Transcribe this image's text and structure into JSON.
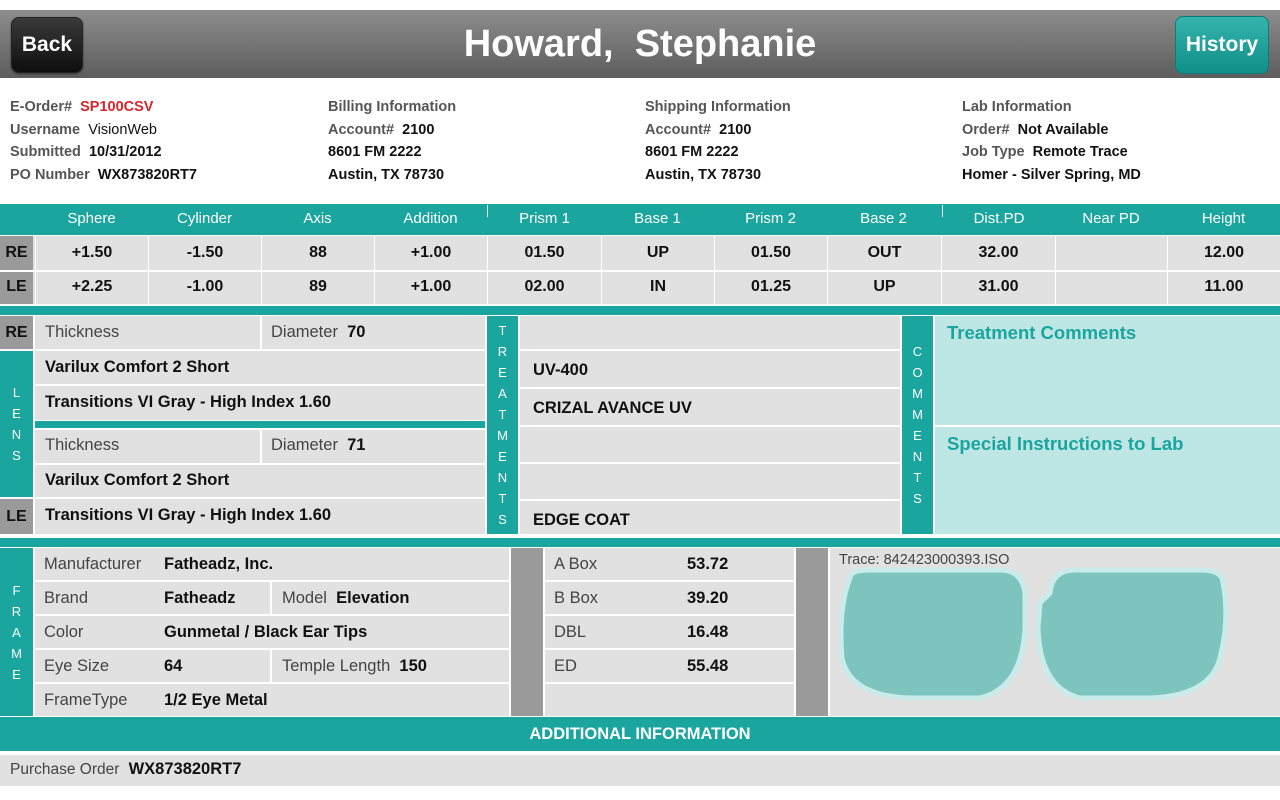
{
  "header": {
    "back_label": "Back",
    "title": "Howard,  Stephanie",
    "history_label": "History"
  },
  "order": {
    "eorder_label": "E-Order#",
    "eorder_value": "SP100CSV",
    "username_label": "Username",
    "username_value": "VisionWeb",
    "submitted_label": "Submitted",
    "submitted_value": "10/31/2012",
    "po_label": "PO Number",
    "po_value": "WX873820RT7"
  },
  "billing": {
    "title": "Billing Information",
    "account_label": "Account#",
    "account_value": "2100",
    "address1": "8601 FM 2222",
    "address2": "Austin, TX 78730"
  },
  "shipping": {
    "title": "Shipping Information",
    "account_label": "Account#",
    "account_value": "2100",
    "address1": "8601 FM 2222",
    "address2": "Austin, TX 78730"
  },
  "lab": {
    "title": "Lab Information",
    "order_label": "Order#",
    "order_value": "Not Available",
    "jobtype_label": "Job Type",
    "jobtype_value": "Remote Trace",
    "location": "Homer - Silver Spring, MD"
  },
  "rx": {
    "headers": [
      "Sphere",
      "Cylinder",
      "Axis",
      "Addition",
      "Prism 1",
      "Base 1",
      "Prism 2",
      "Base 2",
      "Dist.PD",
      "Near PD",
      "Height"
    ],
    "rows": [
      {
        "eye": "RE",
        "values": [
          "+1.50",
          "-1.50",
          "88",
          "+1.00",
          "01.50",
          "UP",
          "01.50",
          "OUT",
          "32.00",
          "",
          "12.00"
        ]
      },
      {
        "eye": "LE",
        "values": [
          "+2.25",
          "-1.00",
          "89",
          "+1.00",
          "02.00",
          "IN",
          "01.25",
          "UP",
          "31.00",
          "",
          "11.00"
        ]
      }
    ]
  },
  "lens": {
    "side_letters": [
      "L",
      "E",
      "N",
      "S"
    ],
    "re_label": "RE",
    "le_label": "LE",
    "re": {
      "thickness_label": "Thickness",
      "diameter_label": "Diameter",
      "diameter_value": "70",
      "design": "Varilux Comfort 2 Short",
      "material": "Transitions VI Gray - High Index 1.60"
    },
    "le": {
      "thickness_label": "Thickness",
      "diameter_label": "Diameter",
      "diameter_value": "71",
      "design": "Varilux Comfort 2 Short",
      "material": "Transitions VI Gray - High Index 1.60"
    }
  },
  "treatments": {
    "side_letters": [
      "T",
      "R",
      "E",
      "A",
      "T",
      "M",
      "E",
      "N",
      "T",
      "S"
    ],
    "items": [
      "",
      "UV-400",
      "CRIZAL AVANCE UV",
      "",
      "",
      "EDGE COAT"
    ]
  },
  "comments": {
    "side_letters": [
      "C",
      "O",
      "M",
      "M",
      "E",
      "N",
      "T",
      "S"
    ],
    "treatment_comments_title": "Treatment Comments",
    "special_instructions_title": "Special Instructions to Lab"
  },
  "frame": {
    "side_letters": [
      "F",
      "R",
      "A",
      "M",
      "E"
    ],
    "manufacturer_label": "Manufacturer",
    "manufacturer_value": "Fatheadz, Inc.",
    "brand_label": "Brand",
    "brand_value": "Fatheadz",
    "model_label": "Model",
    "model_value": "Elevation",
    "color_label": "Color",
    "color_value": "Gunmetal / Black Ear Tips",
    "eyesize_label": "Eye Size",
    "eyesize_value": "64",
    "temple_label": "Temple Length",
    "temple_value": "150",
    "frametype_label": "FrameType",
    "frametype_value": "1/2 Eye Metal"
  },
  "measurements": {
    "a_box_label": "A Box",
    "a_box_value": "53.72",
    "b_box_label": "B Box",
    "b_box_value": "39.20",
    "dbl_label": "DBL",
    "dbl_value": "16.48",
    "ed_label": "ED",
    "ed_value": "55.48"
  },
  "trace": {
    "label": "Trace: 842423000393.ISO"
  },
  "additional": {
    "title": "ADDITIONAL INFORMATION",
    "po_label": "Purchase Order",
    "po_value": "WX873820RT7"
  },
  "colors": {
    "teal": "#1aa59f",
    "light_teal": "#bde6e4",
    "grey": "#e1e1e1",
    "dark_grey": "#9a9a9a",
    "red": "#d8262c"
  }
}
